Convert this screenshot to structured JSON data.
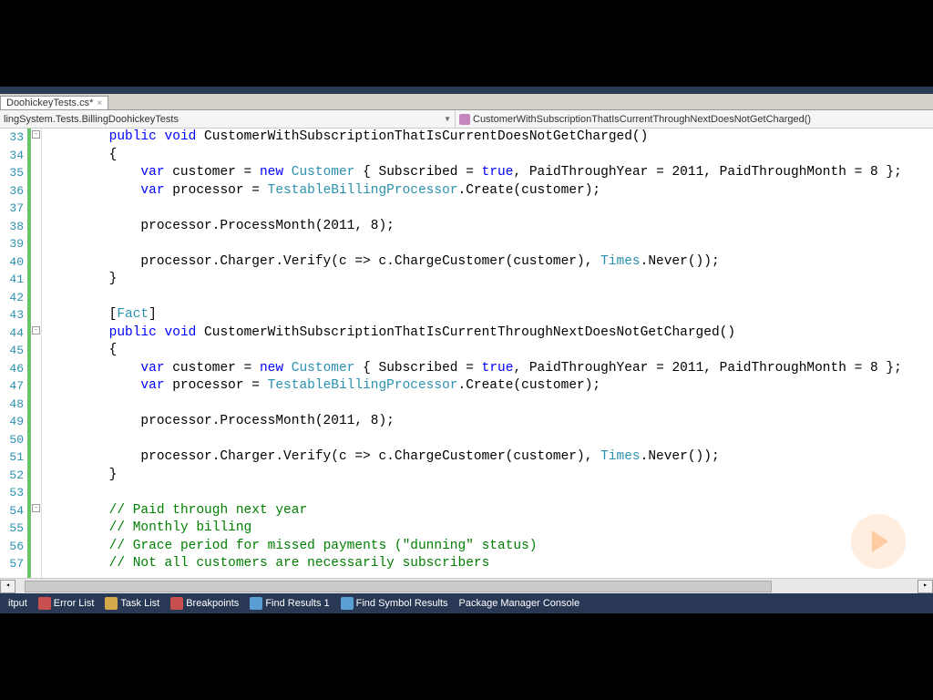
{
  "tab": {
    "name": "DoohickeyTests.cs*"
  },
  "dropdowns": {
    "left": "lingSystem.Tests.BillingDoohickeyTests",
    "right": "CustomerWithSubscriptionThatIsCurrentThroughNextDoesNotGetCharged()"
  },
  "lines": {
    "start": 33,
    "end": 57
  },
  "code": {
    "l33": {
      "indent": "        ",
      "tokens": [
        [
          "kw",
          "public"
        ],
        [
          "",
          " "
        ],
        [
          "kw",
          "void"
        ],
        [
          "",
          " CustomerWithSubscriptionThatIsCurrentDoesNotGetCharged()"
        ]
      ]
    },
    "l34": {
      "indent": "        ",
      "tokens": [
        [
          "",
          "{"
        ]
      ]
    },
    "l35": {
      "indent": "            ",
      "tokens": [
        [
          "kw",
          "var"
        ],
        [
          "",
          " customer = "
        ],
        [
          "kw",
          "new"
        ],
        [
          "",
          " "
        ],
        [
          "type",
          "Customer"
        ],
        [
          "",
          " { Subscribed = "
        ],
        [
          "kw",
          "true"
        ],
        [
          "",
          ", PaidThroughYear = 2011, PaidThroughMonth = 8 };"
        ]
      ]
    },
    "l36": {
      "indent": "            ",
      "tokens": [
        [
          "kw",
          "var"
        ],
        [
          "",
          " processor = "
        ],
        [
          "type",
          "TestableBillingProcessor"
        ],
        [
          "",
          ".Create(customer);"
        ]
      ]
    },
    "l37": {
      "indent": "",
      "tokens": []
    },
    "l38": {
      "indent": "            ",
      "tokens": [
        [
          "",
          "processor.ProcessMonth(2011, 8);"
        ]
      ]
    },
    "l39": {
      "indent": "",
      "tokens": []
    },
    "l40": {
      "indent": "            ",
      "tokens": [
        [
          "",
          "processor.Charger.Verify(c => c.ChargeCustomer(customer), "
        ],
        [
          "type",
          "Times"
        ],
        [
          "",
          ".Never());"
        ]
      ]
    },
    "l41": {
      "indent": "        ",
      "tokens": [
        [
          "",
          "}"
        ]
      ]
    },
    "l42": {
      "indent": "",
      "tokens": []
    },
    "l43": {
      "indent": "        ",
      "tokens": [
        [
          "",
          "["
        ],
        [
          "type",
          "Fact"
        ],
        [
          "",
          "]"
        ]
      ]
    },
    "l44": {
      "indent": "        ",
      "tokens": [
        [
          "kw",
          "public"
        ],
        [
          "",
          " "
        ],
        [
          "kw",
          "void"
        ],
        [
          "",
          " CustomerWithSubscriptionThatIsCurrentThroughNextDoesNotGetCharged()"
        ]
      ]
    },
    "l45": {
      "indent": "        ",
      "tokens": [
        [
          "",
          "{"
        ]
      ]
    },
    "l46": {
      "indent": "            ",
      "tokens": [
        [
          "kw",
          "var"
        ],
        [
          "",
          " customer = "
        ],
        [
          "kw",
          "new"
        ],
        [
          "",
          " "
        ],
        [
          "type",
          "Customer"
        ],
        [
          "",
          " { Subscribed = "
        ],
        [
          "kw",
          "true"
        ],
        [
          "",
          ", PaidThroughYear = 2011, PaidThroughMonth = 8 };"
        ]
      ]
    },
    "l47": {
      "indent": "            ",
      "tokens": [
        [
          "kw",
          "var"
        ],
        [
          "",
          " processor = "
        ],
        [
          "type",
          "TestableBillingProcessor"
        ],
        [
          "",
          ".Create(customer);"
        ]
      ]
    },
    "l48": {
      "indent": "",
      "tokens": []
    },
    "l49": {
      "indent": "            ",
      "tokens": [
        [
          "",
          "processor.ProcessMonth(2011, 8);"
        ]
      ]
    },
    "l50": {
      "indent": "",
      "tokens": []
    },
    "l51": {
      "indent": "            ",
      "tokens": [
        [
          "",
          "processor.Charger.Verify(c => c.ChargeCustomer(customer), "
        ],
        [
          "type",
          "Times"
        ],
        [
          "",
          ".Never());"
        ]
      ]
    },
    "l52": {
      "indent": "        ",
      "tokens": [
        [
          "",
          "}"
        ]
      ]
    },
    "l53": {
      "indent": "",
      "tokens": []
    },
    "l54": {
      "indent": "        ",
      "tokens": [
        [
          "cmt",
          "// Paid through next year"
        ]
      ]
    },
    "l55": {
      "indent": "        ",
      "tokens": [
        [
          "cmt",
          "// Monthly billing"
        ]
      ]
    },
    "l56": {
      "indent": "        ",
      "tokens": [
        [
          "cmt",
          "// Grace period for missed payments (\"dunning\" status)"
        ]
      ]
    },
    "l57": {
      "indent": "        ",
      "tokens": [
        [
          "cmt",
          "// Not all customers are necessarily subscribers"
        ]
      ]
    }
  },
  "statusbar": {
    "items": [
      "itput",
      "Error List",
      "Task List",
      "Breakpoints",
      "Find Results 1",
      "Find Symbol Results",
      "Package Manager Console"
    ]
  }
}
